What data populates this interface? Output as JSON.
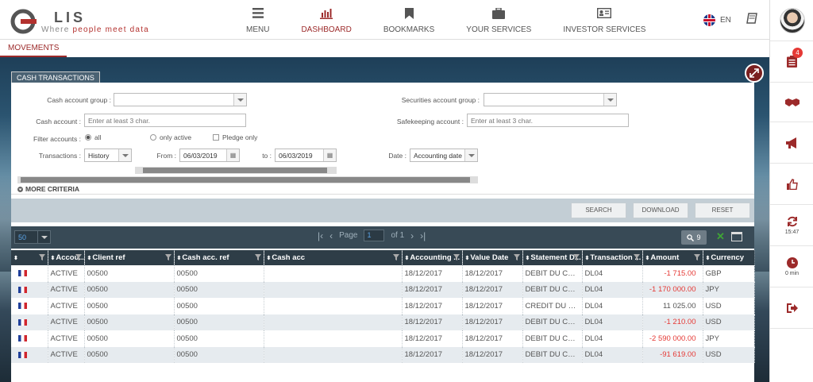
{
  "brand": {
    "logo_text": "LIS",
    "tagline_1": "Where ",
    "tagline_2": "people meet",
    "tagline_3": " data"
  },
  "nav": [
    {
      "label": "MENU",
      "icon": "hamburger-icon"
    },
    {
      "label": "DASHBOARD",
      "icon": "bar-chart-icon",
      "active": true
    },
    {
      "label": "BOOKMARKS",
      "icon": "bookmark-icon"
    },
    {
      "label": "YOUR SERVICES",
      "icon": "briefcase-icon"
    },
    {
      "label": "INVESTOR SERVICES",
      "icon": "id-card-icon"
    }
  ],
  "lang": "EN",
  "rightbar": {
    "notifications_count": "4",
    "clock_time": "15:47",
    "timer_label": "0 min"
  },
  "tabs": {
    "movements": "MOVEMENTS",
    "cash_transactions": "CASH TRANSACTIONS"
  },
  "form": {
    "cash_account_group_label": "Cash account group :",
    "securities_account_group_label": "Securities account group :",
    "cash_account_label": "Cash account :",
    "cash_account_placeholder": "Enter at least 3 char.",
    "safekeeping_account_label": "Safekeeping account :",
    "safekeeping_account_placeholder": "Enter at least 3 char.",
    "filter_accounts_label": "Filter accounts :",
    "filter_all": "all",
    "filter_only_active": "only active",
    "pledge_only": "Pledge only",
    "transactions_label": "Transactions :",
    "transactions_value": "History",
    "from_label": "From :",
    "from_value": "06/03/2019",
    "to_label": "to :",
    "to_value": "06/03/2019",
    "date_label": "Date :",
    "date_value": "Accounting date",
    "more_criteria": "MORE CRITERIA"
  },
  "actions": {
    "search": "SEARCH",
    "download": "DOWNLOAD",
    "reset": "RESET"
  },
  "grid": {
    "page_size": "50",
    "page_label": "Page",
    "page_value": "1",
    "of_label": "of 1",
    "count": "9",
    "columns": [
      "",
      "Accou...",
      "Client ref",
      "Cash acc. ref",
      "Cash acc",
      "Accounting ...",
      "Value Date",
      "Statement D...",
      "Transaction ...",
      "Amount",
      "Currency"
    ],
    "rows": [
      {
        "status": "ACTIVE",
        "client_ref": "00500",
        "cash_acc_ref": "00500",
        "cash_acc": "",
        "accounting": "18/12/2017",
        "value_date": "18/12/2017",
        "statement": "DEBIT DU CO...",
        "transaction": "DL04",
        "amount": "-1 715.00",
        "neg": true,
        "currency": "GBP"
      },
      {
        "status": "ACTIVE",
        "client_ref": "00500",
        "cash_acc_ref": "00500",
        "cash_acc": "",
        "accounting": "18/12/2017",
        "value_date": "18/12/2017",
        "statement": "DEBIT DU CO...",
        "transaction": "DL04",
        "amount": "-1 170 000.00",
        "neg": true,
        "currency": "JPY"
      },
      {
        "status": "ACTIVE",
        "client_ref": "00500",
        "cash_acc_ref": "00500",
        "cash_acc": "",
        "accounting": "18/12/2017",
        "value_date": "18/12/2017",
        "statement": "CREDIT DU C...",
        "transaction": "DL04",
        "amount": "11 025.00",
        "neg": false,
        "currency": "USD"
      },
      {
        "status": "ACTIVE",
        "client_ref": "00500",
        "cash_acc_ref": "00500",
        "cash_acc": "",
        "accounting": "18/12/2017",
        "value_date": "18/12/2017",
        "statement": "DEBIT DU CO...",
        "transaction": "DL04",
        "amount": "-1 210.00",
        "neg": true,
        "currency": "USD"
      },
      {
        "status": "ACTIVE",
        "client_ref": "00500",
        "cash_acc_ref": "00500",
        "cash_acc": "",
        "accounting": "18/12/2017",
        "value_date": "18/12/2017",
        "statement": "DEBIT DU CO...",
        "transaction": "DL04",
        "amount": "-2 590 000.00",
        "neg": true,
        "currency": "JPY"
      },
      {
        "status": "ACTIVE",
        "client_ref": "00500",
        "cash_acc_ref": "00500",
        "cash_acc": "",
        "accounting": "18/12/2017",
        "value_date": "18/12/2017",
        "statement": "DEBIT DU CO...",
        "transaction": "DL04",
        "amount": "-91 619.00",
        "neg": true,
        "currency": "USD"
      }
    ]
  },
  "colors": {
    "accent": "#9c2a2a",
    "negative": "#e53935",
    "grid_header": "#2e3d47"
  }
}
